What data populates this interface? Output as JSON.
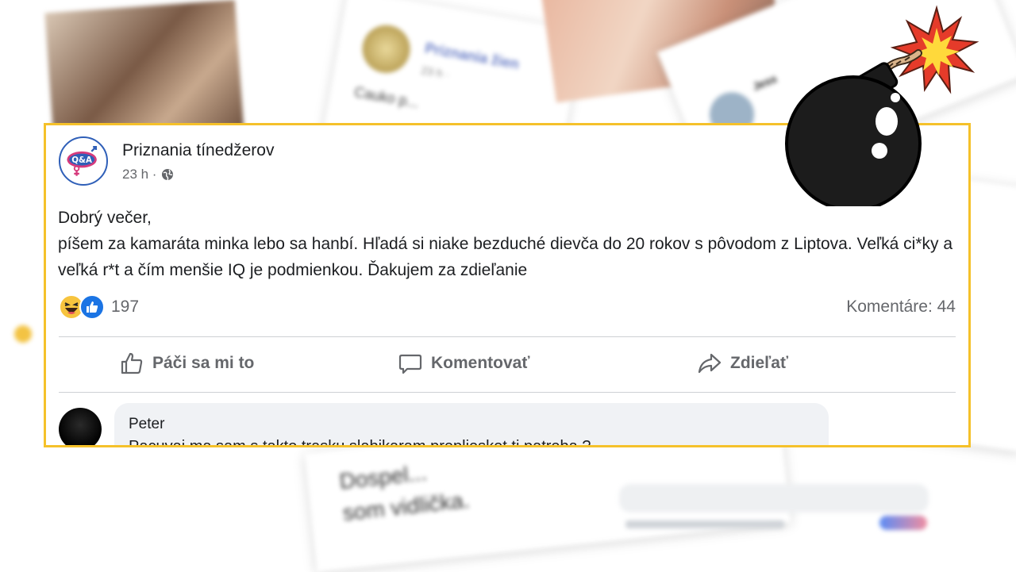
{
  "post": {
    "page_name": "Priznania tínedžerov",
    "time": "23 h ·",
    "body": {
      "line1": "Dobrý večer,",
      "line2": "píšem za kamaráta minka lebo sa hanbí. Hľadá si niake bezduché dievča do 20 rokov s pôvodom z Liptova. Veľká ci*ky a veľká r*t a čím menšie IQ je podmienkou. Ďakujem za zdieľanie"
    },
    "reaction_count": "197",
    "comments_label": "Komentáre: 44",
    "actions": {
      "like": "Páči sa mi to",
      "comment": "Komentovať",
      "share": "Zdieľať"
    },
    "comment": {
      "author": "Peter",
      "text": "Pacuvaj ma sam s takto trasku slabikaram prepliesket ti patreba ?"
    }
  },
  "background": {
    "post_page_name": "Priznania žien",
    "post_time": "23 h ·",
    "post_text": "Cauko p...",
    "tweet_name": "Jess",
    "bottom_text_1": "Dospel...",
    "bottom_text_2": "som vidlička."
  },
  "colors": {
    "highlight_border": "#f5c12a",
    "brand_blue": "#2f5fb8",
    "text_secondary": "#65676b"
  },
  "icons": [
    "globe-icon",
    "haha-reaction-icon",
    "like-reaction-icon",
    "thumbs-up-icon",
    "comment-icon",
    "share-icon",
    "bomb-icon"
  ]
}
